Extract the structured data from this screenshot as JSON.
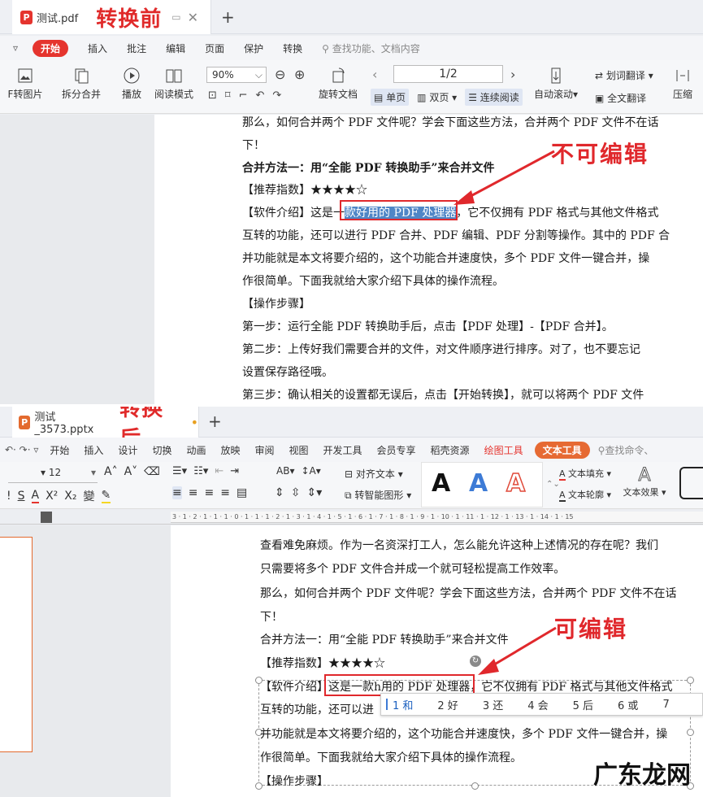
{
  "top": {
    "tab": {
      "logo": "P",
      "name": "测试.pdf"
    },
    "label": "转换前",
    "menu": [
      "开始",
      "插入",
      "批注",
      "编辑",
      "页面",
      "保护",
      "转换"
    ],
    "search": "查找功能、文档内容",
    "zoom": "90%",
    "page_indicator": "1/2",
    "tools": {
      "pdf_to_image": "F转图片",
      "split_merge": "拆分合并",
      "play": "播放",
      "reading_mode": "阅读模式",
      "rotate": "旋转文档",
      "single": "单页",
      "double": "双页",
      "continuous": "连续阅读",
      "auto_scroll": "自动滚动",
      "word_translate": "划词翻译",
      "full_translate": "全文翻译",
      "compress": "压缩"
    },
    "annotation": "不可编辑",
    "lines": [
      "那么，如何合并两个 PDF 文件呢？学会下面这些方法，合并两个 PDF 文件不在话",
      "下！",
      "合并方法一：用“全能 PDF 转换助手”来合并文件",
      "【推荐指数】★★★★☆",
      "互转的功能，还可以进行 PDF 合并、PDF 编辑、PDF 分割等操作。其中的 PDF 合",
      "并功能就是本文将要介绍的，这个功能合并速度快，多个 PDF 文件一键合并，操",
      "作很简单。下面我就给大家介绍下具体的操作流程。",
      "【操作步骤】",
      "第一步：运行全能 PDF 转换助手后，点击【PDF 处理】-【PDF 合并】。",
      "第二步：上传好我们需要合并的文件，对文件顺序进行排序。对了，也不要忘记",
      "设置保存路径哦。",
      "第三步：确认相关的设置都无误后，点击【开始转换】，就可以将两个 PDF 文件"
    ],
    "intro_prefix": "【软件介绍】这是一",
    "intro_highlight": "款好用的 PDF 处理器",
    "intro_suffix": "，它不仅拥有 PDF 格式与其他文件格式"
  },
  "bottom": {
    "tab": {
      "logo": "P",
      "name": "测试_3573.pptx"
    },
    "label": "转换后",
    "menu": [
      "开始",
      "插入",
      "设计",
      "切换",
      "动画",
      "放映",
      "审阅",
      "视图",
      "开发工具",
      "会员专享",
      "稻壳资源"
    ],
    "menu_draw": "绘图工具",
    "menu_text": "文本工具",
    "search": "查找命令、",
    "font_size": "12",
    "tools": {
      "align_text": "对齐文本",
      "smart_shape": "转智能图形",
      "text_fill": "文本填充",
      "text_outline": "文本轮廓",
      "text_effect": "文本效果"
    },
    "ruler": "3 · 1 · 2 · 1 · 1 · 1 · 0 · 1 · 1 · 1 · 2 · 1 · 3 · 1 · 4 · 1 · 5 · 1 · 6 · 1 · 7 · 1 · 8 · 1 · 9 · 1 · 10 · 1 · 11 · 1 · 12 · 1 · 13 · 1 · 14 · 1 · 15",
    "annotation": "可编辑",
    "lines": [
      "查看难免麻烦。作为一名资深打工人，怎么能允许这种上述情况的存在呢？我们",
      "只需要将多个 PDF 文件合并成一个就可轻松提高工作效率。",
      "那么，如何合并两个 PDF 文件呢？学会下面这些方法，合并两个 PDF 文件不在话",
      "下！",
      "合并方法一：用“全能 PDF 转换助手”来合并文件",
      "【推荐指数】★★★★☆",
      "【软件介绍】这是一款h用的 PDF 处理器，它不仅拥有 PDF 格式与其他文件格式",
      "互转的功能，还可以进",
      "并功能就是本文将要介绍的，这个功能合并速度快，多个 PDF 文件一键合并，操",
      "作很简单。下面我就给大家介绍下具体的操作流程。",
      "【操作步骤】"
    ],
    "candidates": [
      "1 和",
      "2 好",
      "3 还",
      "4 会",
      "5 后",
      "6 或",
      "7"
    ],
    "watermark": "广东龙网"
  },
  "colors": {
    "red": "#e0282c",
    "accent": "#e5342e",
    "highlight": "#4f86c6"
  }
}
